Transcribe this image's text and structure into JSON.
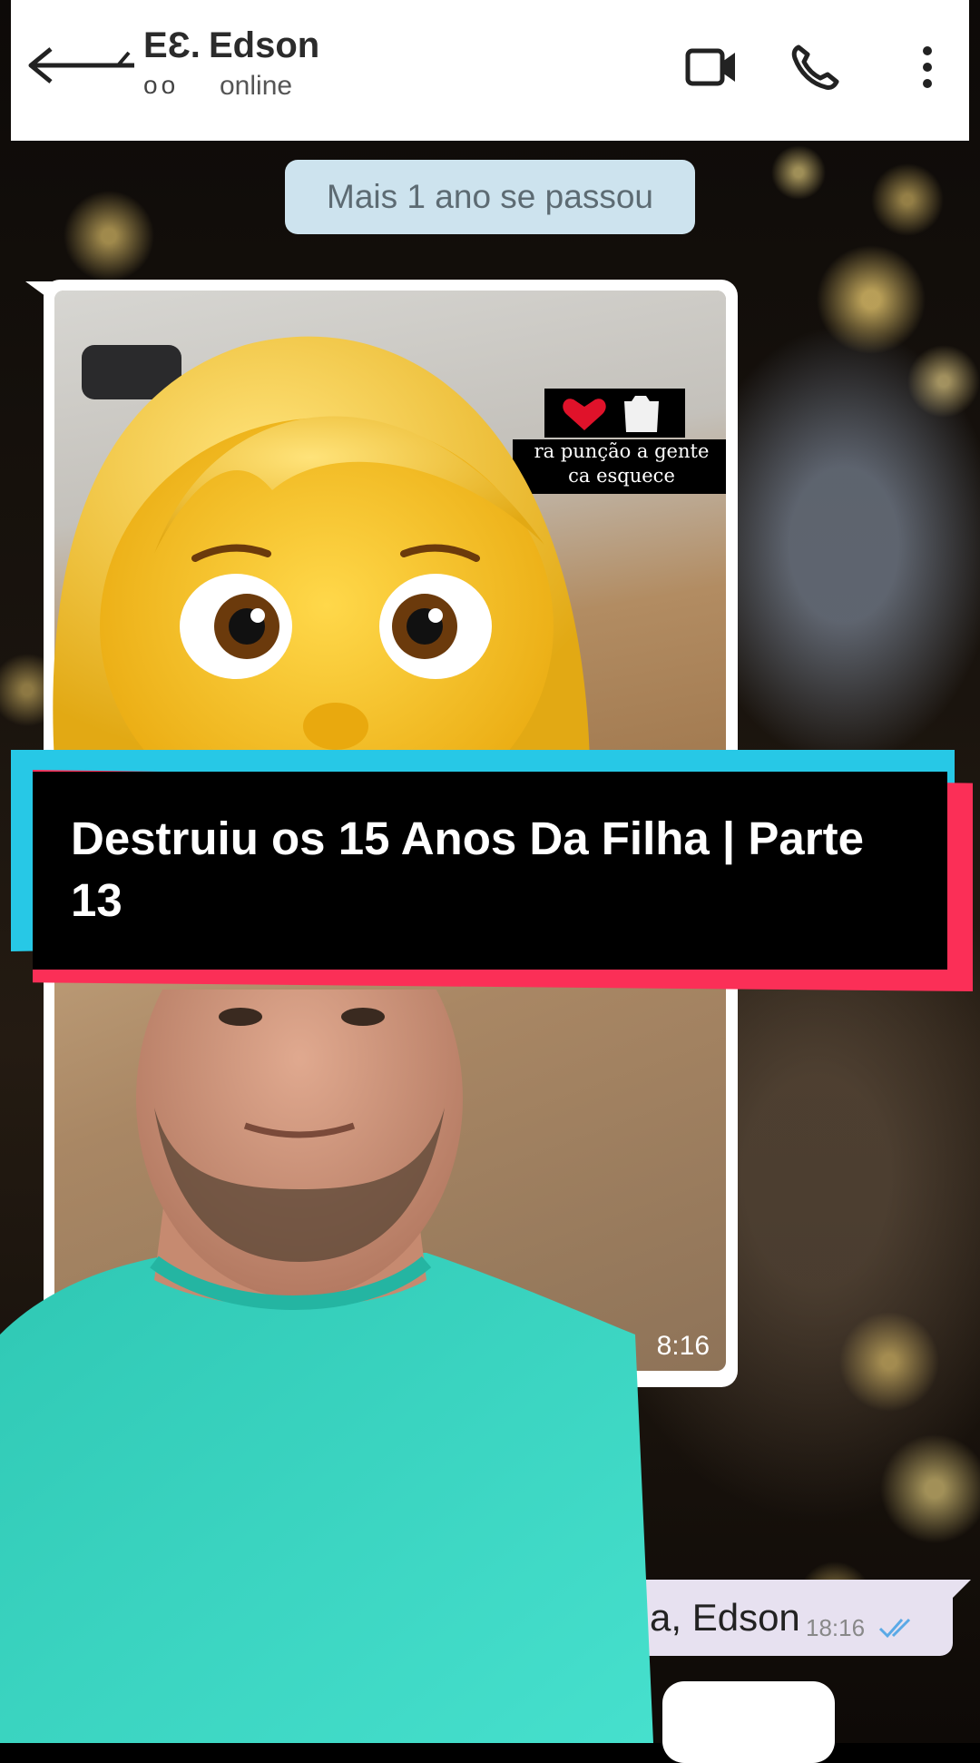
{
  "header": {
    "contact_prefix": "EƐ.",
    "contact_name": "Edson",
    "avatar_initials": "oo",
    "status": "online",
    "icons": [
      "back-arrow-icon",
      "video-call-icon",
      "phone-icon",
      "more-vert-icon"
    ]
  },
  "chat": {
    "date_chip": "Mais 1 ano se passou",
    "image_message": {
      "caption_line1": "ra punção a gente",
      "caption_line2": "ca esquece",
      "caption_emojis": [
        "❤️",
        "🥼"
      ],
      "time": "8:16"
    },
    "outgoing_message": {
      "text": "a, Edson",
      "time": "18:16",
      "status_icon": "double-check-icon"
    }
  },
  "overlay": {
    "emoji": "woman-face-emoji",
    "title": "Destruiu os 15 Anos Da Filha | Parte 13",
    "colors": {
      "cyan": "#27c8e6",
      "red": "#fb2f57",
      "shirt": "#3fd6c3"
    }
  }
}
